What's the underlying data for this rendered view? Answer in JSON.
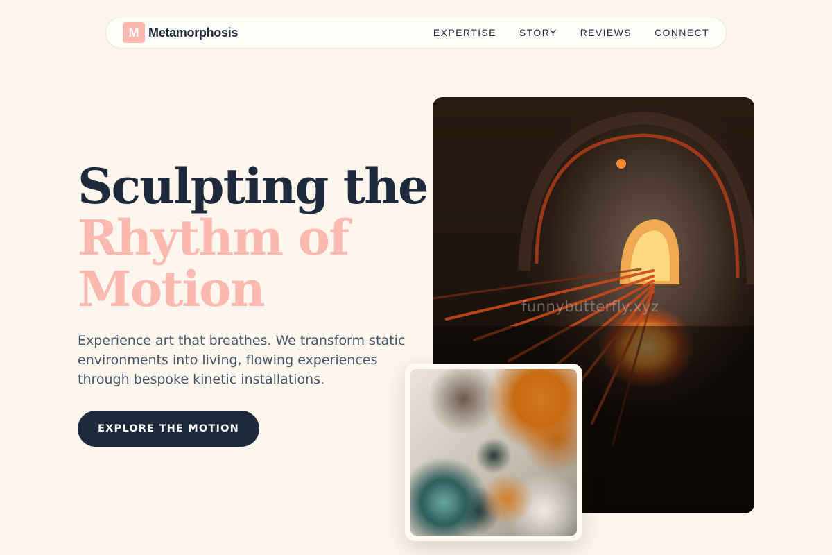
{
  "brand": {
    "mark": "M",
    "name": "Metamorphosis"
  },
  "nav": {
    "links": [
      "EXPERTISE",
      "STORY",
      "REVIEWS",
      "CONNECT"
    ]
  },
  "hero": {
    "title_line1": "Sculpting the",
    "title_line2": "Rhythm of",
    "title_line3": "Motion",
    "description": "Experience art that breathes. We transform static environments into living, flowing experiences through bespoke kinetic installations.",
    "cta_label": "EXPLORE THE MOTION"
  },
  "images": {
    "watermark": "funnybutterfly.xyz"
  },
  "colors": {
    "background": "#fdf6ee",
    "primary": "#1e293b",
    "accent": "#fbb9b0",
    "text_muted": "#475569"
  }
}
